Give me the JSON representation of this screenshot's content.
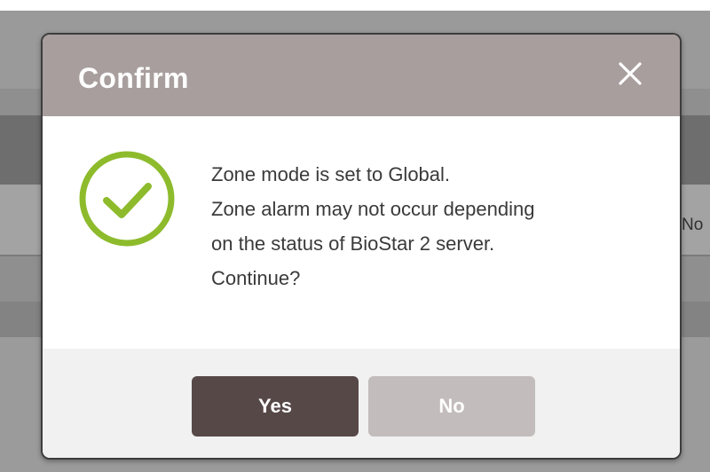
{
  "background": {
    "side_text": "No"
  },
  "dialog": {
    "title": "Confirm",
    "close_icon": "close-icon",
    "status_icon": "check-circle-icon",
    "message_lines": [
      "Zone mode is set to Global.",
      "Zone alarm may not occur depending",
      "on the status of BioStar 2 server.",
      "Continue?"
    ],
    "buttons": {
      "yes_label": "Yes",
      "no_label": "No"
    }
  },
  "colors": {
    "header_bg": "#a79e9d",
    "success_green": "#8dbb2c",
    "primary_button": "#574848",
    "secondary_button": "#c3bcbc"
  }
}
